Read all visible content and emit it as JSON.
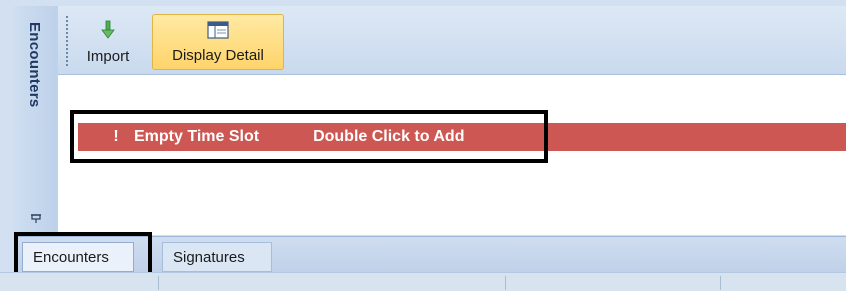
{
  "sidebar": {
    "title": "Encounters",
    "pin_icon": "pin-icon"
  },
  "toolbar": {
    "import_label": "Import",
    "import_icon": "import-arrow-icon",
    "display_detail_label": "Display Detail",
    "display_detail_icon": "display-detail-icon",
    "active_color": "#ffd46a"
  },
  "schedule": {
    "slot_marker": "!",
    "slot_title": "Empty Time Slot",
    "slot_action": "Double Click to Add",
    "slot_color": "#cd5752"
  },
  "tabs": [
    {
      "label": "Encounters",
      "selected": true
    },
    {
      "label": "Signatures",
      "selected": false
    }
  ]
}
